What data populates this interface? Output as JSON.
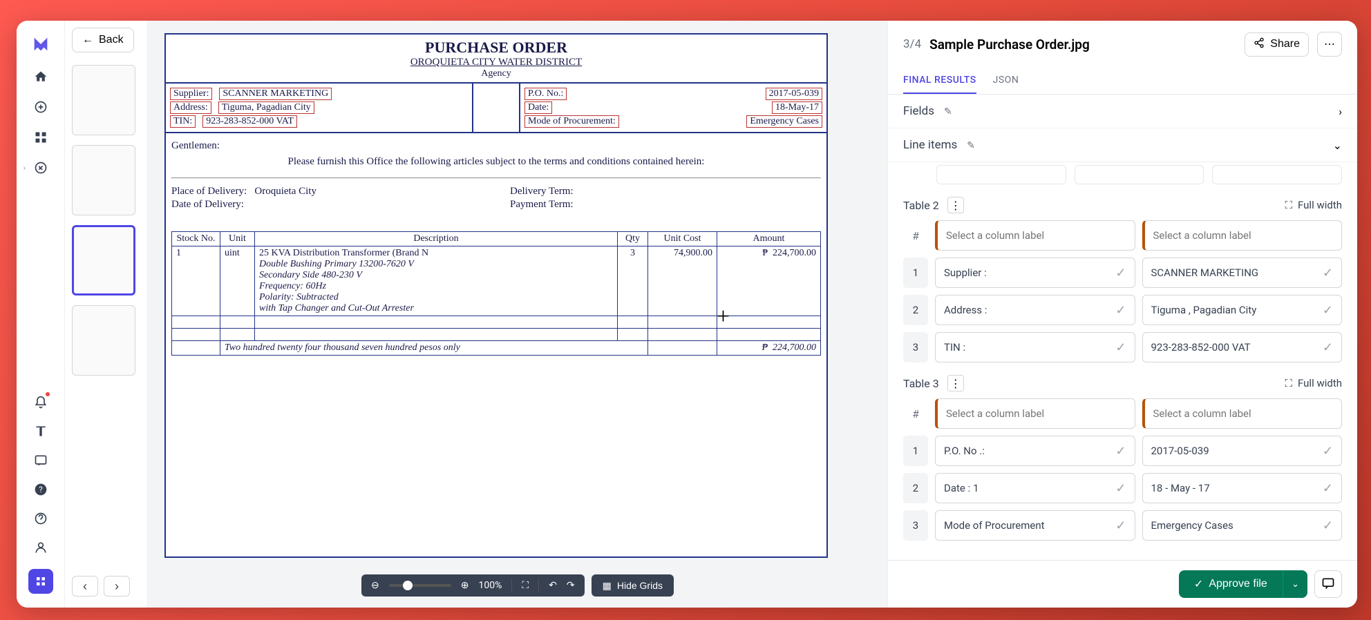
{
  "nav": {
    "back_label": "Back"
  },
  "header": {
    "page_counter": "3/4",
    "filename": "Sample Purchase Order.jpg",
    "share_label": "Share"
  },
  "tabs": {
    "final_results": "FINAL RESULTS",
    "json": "JSON"
  },
  "sections": {
    "fields": "Fields",
    "line_items": "Line items"
  },
  "column_placeholder": "Select a column label",
  "full_width_label": "Full width",
  "hash": "#",
  "tables": {
    "t2": {
      "name": "Table 2",
      "rows": [
        {
          "n": "1",
          "c1": "Supplier :",
          "c2": "SCANNER MARKETING"
        },
        {
          "n": "2",
          "c1": "Address :",
          "c2": "Tiguma , Pagadian City"
        },
        {
          "n": "3",
          "c1": "TIN :",
          "c2": "923-283-852-000 VAT"
        }
      ]
    },
    "t3": {
      "name": "Table 3",
      "rows": [
        {
          "n": "1",
          "c1": "P.O. No .:",
          "c2": "2017-05-039"
        },
        {
          "n": "2",
          "c1": "Date : 1",
          "c2": "18 - May - 17"
        },
        {
          "n": "3",
          "c1": "Mode of Procurement",
          "c2": "Emergency Cases"
        }
      ]
    }
  },
  "doc_toolbar": {
    "zoom_percent": "100%",
    "hide_grids": "Hide Grids"
  },
  "footer": {
    "approve_label": "Approve file"
  },
  "document": {
    "title": "PURCHASE ORDER",
    "subtitle": "OROQUIETA CITY WATER DISTRICT",
    "agency": "Agency",
    "left": {
      "supplier_l": "Supplier:",
      "supplier_v": "SCANNER MARKETING",
      "address_l": "Address:",
      "address_v": "Tiguma, Pagadian City",
      "tin_l": "TIN:",
      "tin_v": "923-283-852-000 VAT"
    },
    "right": {
      "po_l": "P.O. No.:",
      "po_v": "2017-05-039",
      "date_l": "Date:",
      "date_v": "18-May-17",
      "mop_l": "Mode of Procurement:",
      "mop_v": "Emergency Cases"
    },
    "gentlemen": "Gentlemen:",
    "pleasetext": "Please furnish this Office the following articles subject to the terms and conditions contained herein:",
    "pod_l": "Place of Delivery:",
    "pod_v": "Oroquieta City",
    "dod_l": "Date of Delivery:",
    "dt_l": "Delivery Term:",
    "pt_l": "Payment Term:",
    "cols": {
      "stock": "Stock No.",
      "unit": "Unit",
      "desc": "Description",
      "qty": "Qty",
      "ucost": "Unit Cost",
      "amount": "Amount"
    },
    "item": {
      "stock": "1",
      "unit": "uint",
      "desc1": "25 KVA Distribution Transformer (Brand N",
      "desc2": "Double Bushing Primary 13200-7620 V",
      "desc3": "Secondary Side 480-230 V",
      "desc4": "Frequency: 60Hz",
      "desc5": "Polarity: Subtracted",
      "desc6": "with Tap Changer and Cut-Out Arrester",
      "qty": "3",
      "ucost": "74,900.00",
      "curr": "₱",
      "amount": "224,700.00"
    },
    "totalwords": "Two hundred twenty four thousand seven hundred pesos only",
    "total_amount": "224,700.00"
  }
}
